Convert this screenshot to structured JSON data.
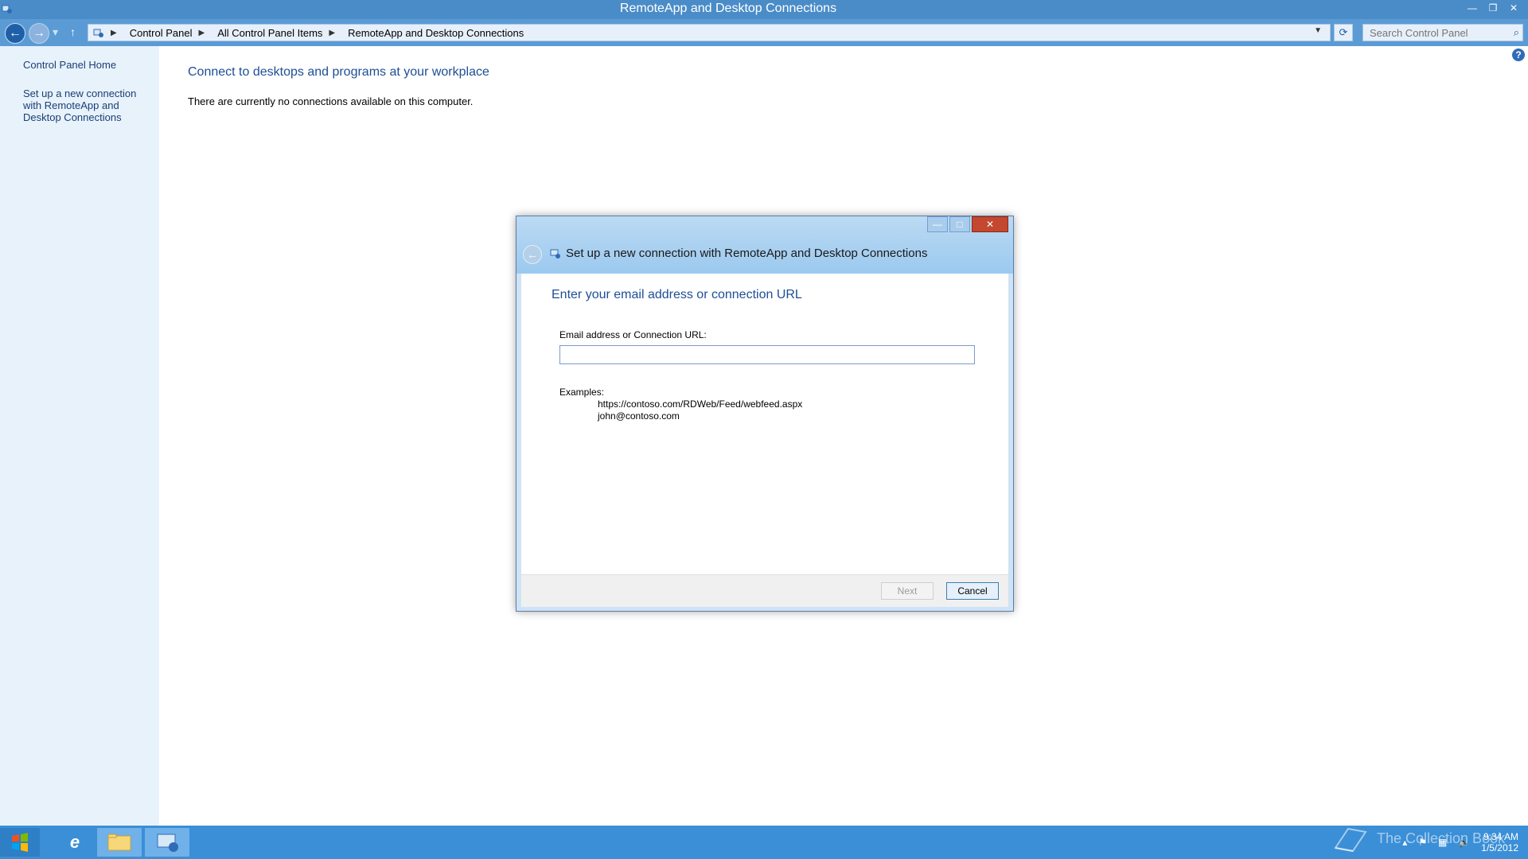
{
  "window": {
    "title": "RemoteApp and Desktop Connections"
  },
  "navbar": {
    "breadcrumbs": [
      "Control Panel",
      "All Control Panel Items",
      "RemoteApp and Desktop Connections"
    ],
    "search_placeholder": "Search Control Panel"
  },
  "sidebar": {
    "home": "Control Panel Home",
    "setup_link": "Set up a new connection with RemoteApp and Desktop Connections"
  },
  "main": {
    "heading": "Connect to desktops and programs at your workplace",
    "message": "There are currently no connections available on this computer."
  },
  "dialog": {
    "title": "Set up a new connection with RemoteApp and Desktop Connections",
    "heading": "Enter your email address or connection URL",
    "field_label": "Email address or Connection URL:",
    "field_value": "",
    "examples_title": "Examples:",
    "examples": [
      "https://contoso.com/RDWeb/Feed/webfeed.aspx",
      "john@contoso.com"
    ],
    "next_label": "Next",
    "cancel_label": "Cancel"
  },
  "taskbar": {
    "time": "9:34 AM",
    "date": "1/5/2012"
  },
  "watermark": {
    "text": "The Collection Book"
  },
  "icons": {
    "back": "back-arrow-icon",
    "forward": "forward-arrow-icon",
    "up": "up-arrow-icon",
    "refresh": "refresh-icon",
    "search": "search-icon",
    "help": "help-icon",
    "close": "close-icon",
    "minimize": "minimize-icon",
    "maximize": "maximize-icon"
  },
  "colors": {
    "accent": "#4a8cc8",
    "link": "#1a3e74",
    "heading": "#1e4e95",
    "taskbar": "#3a8fd7"
  }
}
